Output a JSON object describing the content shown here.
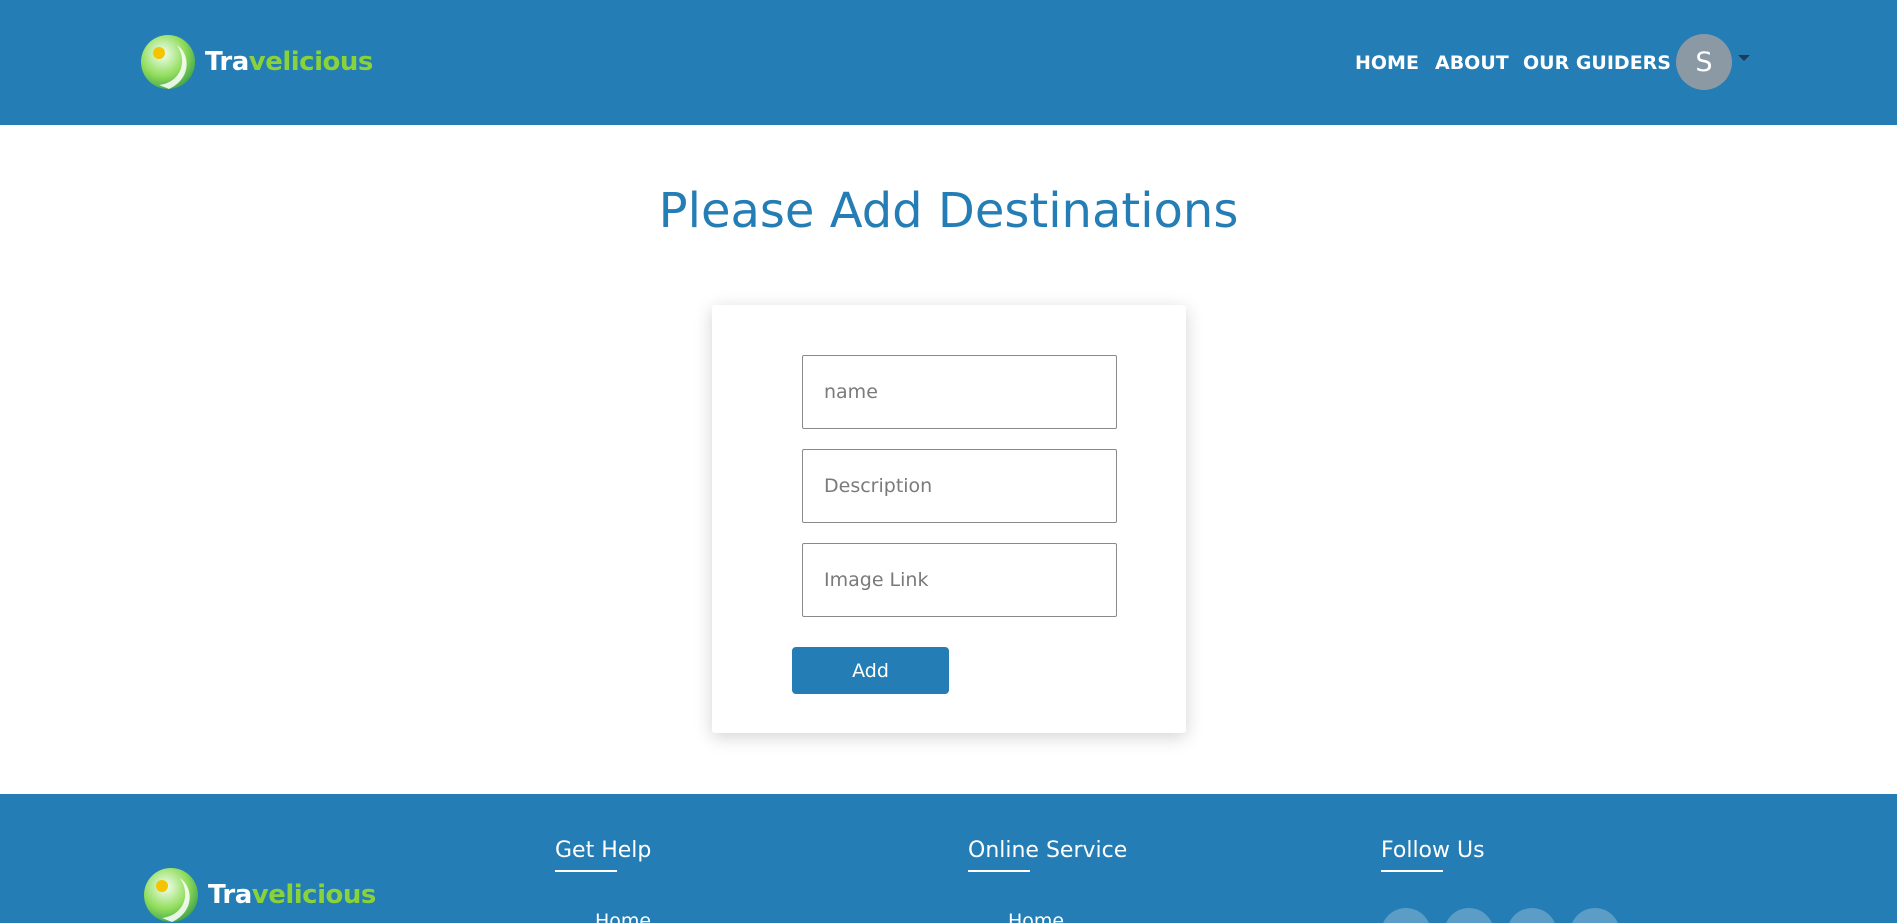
{
  "header": {
    "brand": {
      "part1": "Tra",
      "part2": "velicious"
    },
    "nav": [
      {
        "label": "HOME"
      },
      {
        "label": "ABOUT"
      },
      {
        "label": "OUR GUIDERS"
      }
    ],
    "user": {
      "initial": "S"
    }
  },
  "main": {
    "title": "Please Add Destinations",
    "form": {
      "name_placeholder": "name",
      "description_placeholder": "Description",
      "image_placeholder": "Image Link",
      "submit_label": "Add"
    }
  },
  "footer": {
    "brand": {
      "part1": "Tra",
      "part2": "velicious"
    },
    "columns": [
      {
        "heading": "Get Help",
        "first_link": "Home"
      },
      {
        "heading": "Online Service",
        "first_link": "Home"
      },
      {
        "heading": "Follow Us"
      }
    ],
    "social_icons": [
      "facebook-icon",
      "twitter-icon",
      "instagram-icon",
      "linkedin-icon"
    ]
  },
  "colors": {
    "primary": "#247db4",
    "brand_green": "#8ad23a",
    "avatar_bg": "#8b99a4"
  }
}
